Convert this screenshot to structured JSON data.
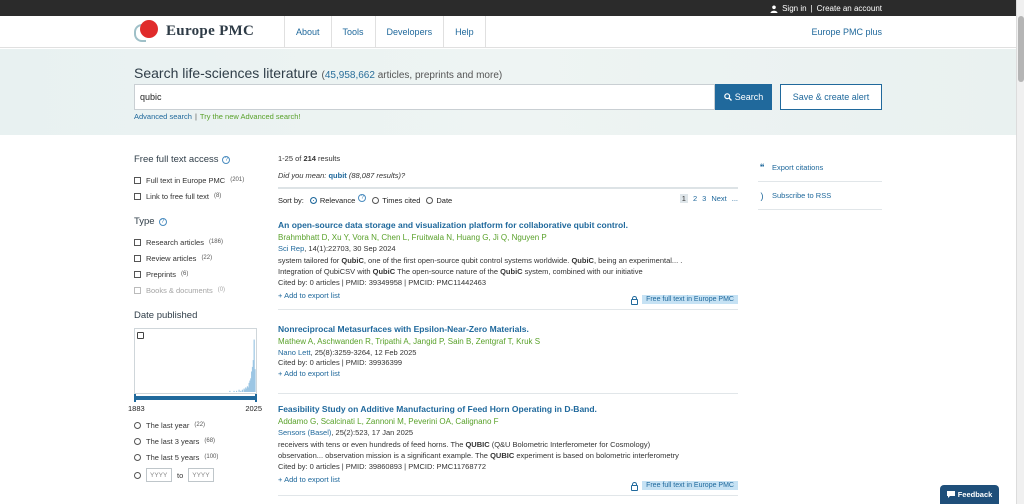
{
  "topbar": {
    "sign_in": "Sign in",
    "sep": "|",
    "create_account": "Create an account"
  },
  "header": {
    "logo_text": "Europe PMC",
    "nav": [
      "About",
      "Tools",
      "Developers",
      "Help"
    ],
    "plus": "Europe PMC plus"
  },
  "hero": {
    "title": "Search life-sciences literature",
    "count_open": "(",
    "count_number": "45,958,662",
    "count_suffix": " articles, preprints and more)",
    "query": "qubic",
    "search_label": "Search",
    "alert_label": "Save & create alert",
    "advanced": "Advanced search",
    "sep": "|",
    "try_new": "Try the new Advanced search!"
  },
  "filters": {
    "free_full_text": {
      "title": "Free full text access",
      "options": [
        {
          "label": "Full text in Europe PMC",
          "count": "(201)"
        },
        {
          "label": "Link to free full text",
          "count": "(8)"
        }
      ]
    },
    "type": {
      "title": "Type",
      "options": [
        {
          "label": "Research articles",
          "count": "(186)"
        },
        {
          "label": "Review articles",
          "count": "(22)"
        },
        {
          "label": "Preprints",
          "count": "(6)"
        },
        {
          "label": "Books & documents",
          "count": "(0)"
        }
      ]
    },
    "date": {
      "title": "Date published",
      "range_start": "1883",
      "range_end": "2025",
      "options": [
        {
          "label": "The last year",
          "count": "(22)"
        },
        {
          "label": "The last 3 years",
          "count": "(68)"
        },
        {
          "label": "The last 5 years",
          "count": "(100)"
        }
      ],
      "from_placeholder": "YYYY",
      "to_label": "to",
      "to_placeholder": "YYYY"
    }
  },
  "chart_data": {
    "type": "bar",
    "x": [
      1995,
      2000,
      2003,
      2006,
      2008,
      2010,
      2012,
      2013,
      2014,
      2015,
      2016,
      2017,
      2018,
      2019,
      2020,
      2021,
      2022,
      2023,
      2024,
      2025
    ],
    "values": [
      1,
      1,
      1,
      2,
      1,
      2,
      3,
      2,
      4,
      3,
      5,
      4,
      8,
      10,
      12,
      18,
      22,
      28,
      46,
      20
    ],
    "xlim": [
      1883,
      2025
    ],
    "ylim": [
      0,
      50
    ]
  },
  "results": {
    "range": "1-25 of ",
    "total": "214",
    "suffix": " results",
    "did_you_mean": "Did you mean: ",
    "suggestion": "qubit",
    "suggestion_count": " (88,087 results)?",
    "sort_by": "Sort by:",
    "sort_options": [
      "Relevance",
      "Times cited",
      "Date"
    ],
    "pages": [
      "1",
      "2",
      "3",
      "Next",
      "..."
    ],
    "add_to_export": "Add to export list",
    "full_text_label": "Free full text in Europe PMC",
    "articles": [
      {
        "title": "An open-source data storage and visualization platform for collaborative qubit control.",
        "authors": "Brahmbhatt D, Xu Y, Vora N, Chen L, Fruitwala N, Huang G, Ji Q, Nguyen P",
        "journal": "Sci Rep",
        "citation": ", 14(1):22703, 30 Sep 2024",
        "snippet": [
          {
            "parts": [
              "system tailored for ",
              "QubiC",
              ", one of the first open-source qubit control systems worldwide. ",
              "QubiC",
              ", being an experimental... ."
            ]
          },
          {
            "parts": [
              "Integration of QubiCSV with ",
              "QubiC",
              " The open-source nature of the ",
              "QubiC",
              " system, combined with our initiative"
            ]
          }
        ],
        "cited": "Cited by: 0 articles | PMID: 39349958 | PMCID: PMC11442463",
        "has_full_text": true
      },
      {
        "title": "Nonreciprocal Metasurfaces with Epsilon-Near-Zero Materials.",
        "authors": "Mathew A, Aschwanden R, Tripathi A, Jangid P, Sain B, Zentgraf T, Kruk S",
        "journal": "Nano Lett",
        "citation": ", 25(8):3259-3264, 12 Feb 2025",
        "snippet": [],
        "cited": "Cited by: 0 articles | PMID: 39936399",
        "has_full_text": false
      },
      {
        "title": "Feasibility Study on Additive Manufacturing of Feed Horn Operating in D-Band.",
        "authors": "Addamo G, Scalcinati L, Zannoni M, Peverini OA, Calignano F",
        "journal": "Sensors (Basel)",
        "citation": ", 25(2):523, 17 Jan 2025",
        "snippet": [
          {
            "parts": [
              "receivers with tens or even hundreds of feed horns. The ",
              "QUBIC",
              " (Q&U Bolometric Interferometer for Cosmology)"
            ]
          },
          {
            "parts": [
              "observation... observation mission is a significant example. The ",
              "QUBIC",
              " experiment is based on bolometric interferometry"
            ]
          }
        ],
        "cited": "Cited by: 0 articles | PMID: 39860893 | PMCID: PMC11768772",
        "has_full_text": true
      }
    ]
  },
  "right": {
    "export_citations": "Export citations",
    "subscribe_rss": "Subscribe to RSS"
  },
  "feedback": "Feedback",
  "colors": {
    "primary": "#20699c",
    "author_green": "#59a12a",
    "topbar": "#2b2b2b"
  }
}
